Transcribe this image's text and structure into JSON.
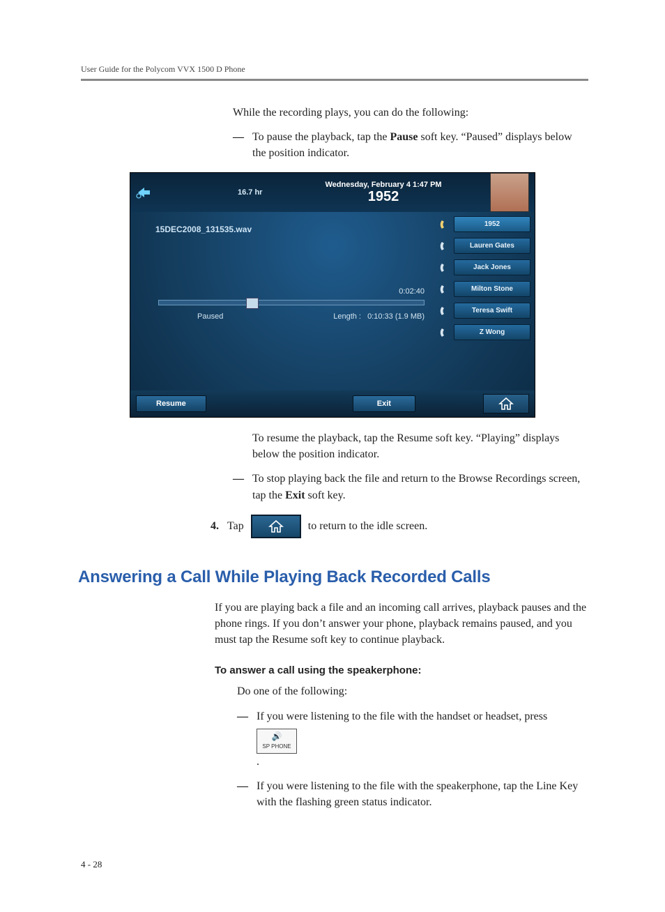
{
  "header": {
    "running": "User Guide for the Polycom VVX 1500 D Phone"
  },
  "intro_para": "While the recording plays, you can do the following:",
  "bullets1": {
    "b1a": "To pause the playback, tap the ",
    "b1b": "Pause",
    "b1c": " soft key. “Paused” displays below the position indicator."
  },
  "phone": {
    "hours": "16.7 hr",
    "datetime": "Wednesday, February 4  1:47 PM",
    "ext": "1952",
    "filename": "15DEC2008_131535.wav",
    "position": "0:02:40",
    "status": "Paused",
    "length_label": "Length :",
    "length_value": "0:10:33 (1.9 MB)",
    "contacts": [
      "1952",
      "Lauren Gates",
      "Jack Jones",
      "Milton Stone",
      "Teresa Swift",
      "Z Wong"
    ],
    "soft_resume": "Resume",
    "soft_exit": "Exit"
  },
  "after1": "To resume the playback, tap the Resume soft key. “Playing” displays below the position indicator.",
  "bullets2": {
    "b1a": "To stop playing back the file and return to the Browse Recordings screen, tap the ",
    "b1b": "Exit",
    "b1c": " soft key."
  },
  "step4": {
    "num": "4.",
    "a": "Tap",
    "b": " to return to the idle screen."
  },
  "section_title": "Answering a Call While Playing Back Recorded Calls",
  "section_para": "If you are playing back a file and an incoming call arrives, playback pauses and the phone rings. If you don’t answer your phone, playback remains paused, and you must tap the Resume soft key to continue playback.",
  "sub_head": "To answer a call using the speakerphone:",
  "do_one": "Do one of the following:",
  "bullets3": {
    "b1": "If you were listening to the file with the handset or headset, press",
    "b2": "If you were listening to the file with the speakerphone, tap the Line Key with the flashing green status indicator."
  },
  "sp_phone": {
    "icon": "🔊",
    "label": "SP PHONE"
  },
  "page_num": "4 - 28"
}
